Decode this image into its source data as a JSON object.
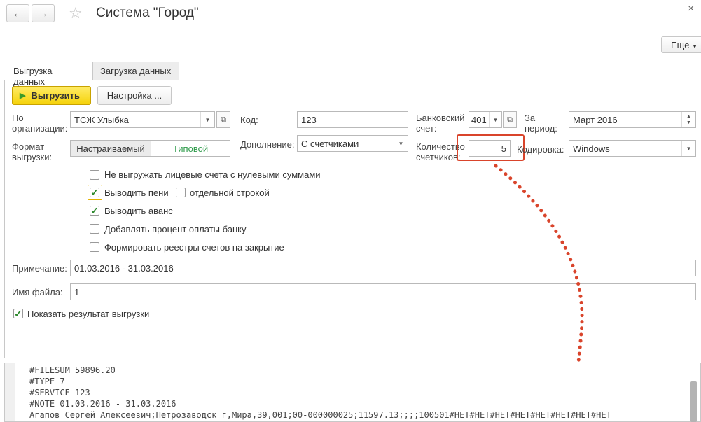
{
  "window": {
    "title": "Система \"Город\"",
    "back_icon": "arrow-left-icon",
    "forward_icon": "arrow-right-icon",
    "favorite_icon": "star-icon",
    "close_label": "×",
    "more_label": "Еще"
  },
  "tabs": [
    {
      "label": "Выгрузка данных",
      "active": true
    },
    {
      "label": "Загрузка данных",
      "active": false
    }
  ],
  "toolbar": {
    "export_label": "Выгрузить",
    "settings_label": "Настройка ..."
  },
  "form": {
    "org_label": "По организации:",
    "org_value": "ТСЖ Улыбка",
    "code_label": "Код:",
    "code_value": "123",
    "bank_label": "Банковский счет:",
    "bank_value": "401",
    "period_label": "За период:",
    "period_value": "Март 2016",
    "format_label": "Формат выгрузки:",
    "format_options": [
      "Настраиваемый",
      "Типовой"
    ],
    "format_selected": "Типовой",
    "addition_label": "Дополнение:",
    "addition_value": "С счетчиками",
    "meters_label": "Количество счетчиков:",
    "meters_value": "5",
    "encoding_label": "Кодировка:",
    "encoding_value": "Windows",
    "note_label": "Примечание:",
    "note_value": "01.03.2016 - 31.03.2016",
    "filename_label": "Имя файла:",
    "filename_value": "1"
  },
  "checkboxes": {
    "no_zero_accounts": {
      "label": "Не выгружать лицевые счета с нулевыми суммами",
      "checked": false
    },
    "show_penalty": {
      "label": "Выводить пени",
      "checked": true
    },
    "separate_line": {
      "label": "отдельной строкой",
      "checked": false
    },
    "show_advance": {
      "label": "Выводить аванс",
      "checked": true
    },
    "bank_percent": {
      "label": "Добавлять процент оплаты банку",
      "checked": false
    },
    "closing_registers": {
      "label": "Формировать реестры счетов на закрытие",
      "checked": false
    },
    "show_result": {
      "label": "Показать результат выгрузки",
      "checked": true
    }
  },
  "output": {
    "lines": [
      "#FILESUM 59896.20",
      "#TYPE 7",
      "#SERVICE 123",
      "#NOTE 01.03.2016 - 31.03.2016",
      "Агапов Сергей Алексеевич;Петрозаводск г,Мира,39,001;00-000000025;11597.13;;;;100501#НЕТ#НЕТ#НЕТ#НЕТ#НЕТ#НЕТ#НЕТ#НЕТ"
    ]
  },
  "colors": {
    "accent_yellow": "#f5d20a",
    "highlight_red": "#d9442b",
    "check_green": "#2f8a2f",
    "selected_segment_text": "#2e9a4a"
  }
}
